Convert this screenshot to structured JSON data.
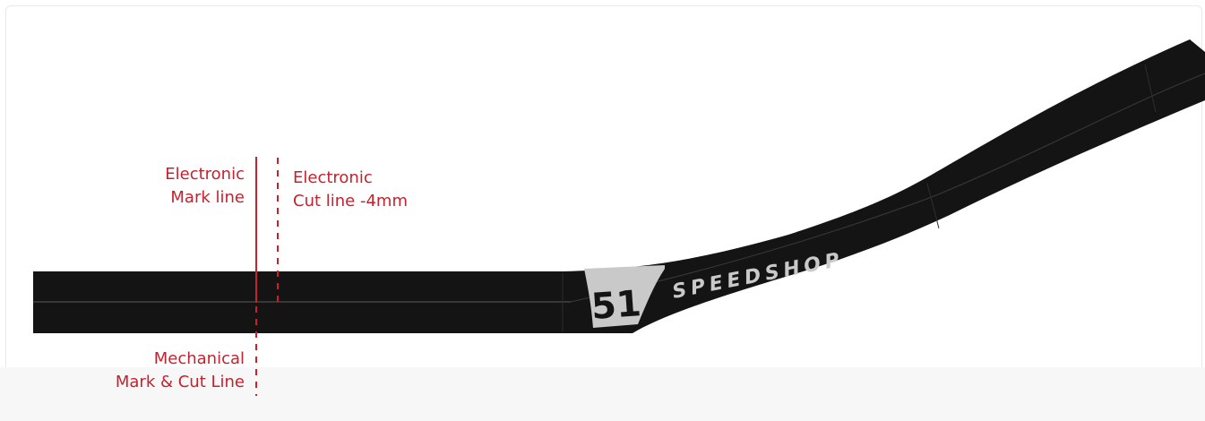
{
  "colors": {
    "accent_red": "#c4222e",
    "bar_black": "#141414",
    "decal_grey": "#c9c9c9",
    "background": "#ffffff"
  },
  "brand": {
    "badge_number": "51",
    "wordmark": "SPEEDSHOP"
  },
  "labels": {
    "electronic_mark": {
      "line1": "Electronic",
      "line2": "Mark line"
    },
    "electronic_cut": {
      "line1": "Electronic",
      "line2": "Cut line -4mm"
    },
    "mechanical_mark": {
      "line1": "Mechanical",
      "line2": "Mark & Cut Line"
    }
  }
}
